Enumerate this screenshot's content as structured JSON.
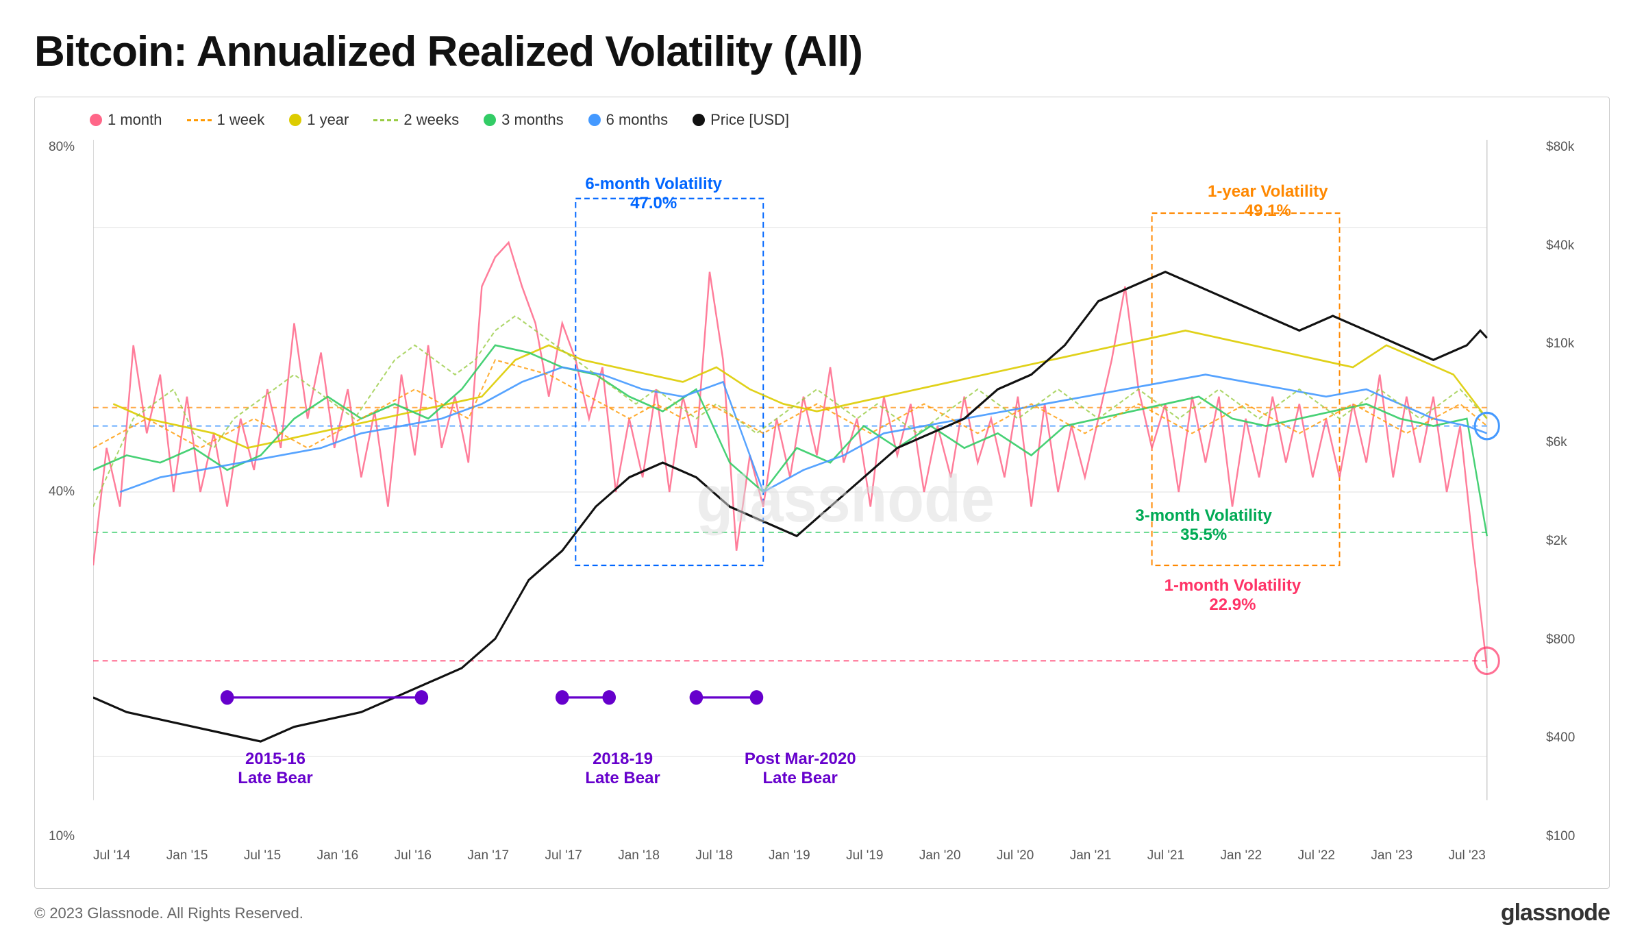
{
  "title": "Bitcoin: Annualized Realized Volatility (All)",
  "legend": {
    "items": [
      {
        "label": "1 month",
        "color": "#ff6688",
        "type": "dot"
      },
      {
        "label": "1 week",
        "color": "#ff9900",
        "type": "dash"
      },
      {
        "label": "1 year",
        "color": "#ddcc00",
        "type": "dot"
      },
      {
        "label": "2 weeks",
        "color": "#99cc44",
        "type": "dash"
      },
      {
        "label": "3 months",
        "color": "#33cc66",
        "type": "dot"
      },
      {
        "label": "6 months",
        "color": "#4499ff",
        "type": "dot"
      },
      {
        "label": "Price [USD]",
        "color": "#111111",
        "type": "dot"
      }
    ]
  },
  "annotations": {
    "six_month": {
      "title": "6-month Volatility",
      "value": "47.0%",
      "color": "#0066ff"
    },
    "one_year": {
      "title": "1-year Volatility",
      "value": "49.1%",
      "color": "#ff8800"
    },
    "three_month": {
      "title": "3-month Volatility",
      "value": "35.5%",
      "color": "#00aa55"
    },
    "one_month": {
      "title": "1-month Volatility",
      "value": "22.9%",
      "color": "#ff3366"
    }
  },
  "bear_periods": [
    {
      "label1": "2015-16",
      "label2": "Late Bear"
    },
    {
      "label1": "2018-19",
      "label2": "Late Bear"
    },
    {
      "label1": "Post Mar-2020",
      "label2": "Late Bear"
    }
  ],
  "y_axis_left": [
    "80%",
    "40%",
    "10%"
  ],
  "y_axis_right": [
    "$80k",
    "$40k",
    "$10k",
    "$6k",
    "$2k",
    "$800",
    "$400",
    "$100"
  ],
  "x_labels": [
    "Jul '14",
    "Jan '15",
    "Jul '15",
    "Jan '16",
    "Jul '16",
    "Jan '17",
    "Jul '17",
    "Jan '18",
    "Jul '18",
    "Jan '19",
    "Jul '19",
    "Jan '20",
    "Jul '20",
    "Jan '21",
    "Jul '21",
    "Jan '22",
    "Jul '22",
    "Jan '23",
    "Jul '23"
  ],
  "footer": {
    "copyright": "© 2023 Glassnode. All Rights Reserved.",
    "logo": "glassnode"
  }
}
